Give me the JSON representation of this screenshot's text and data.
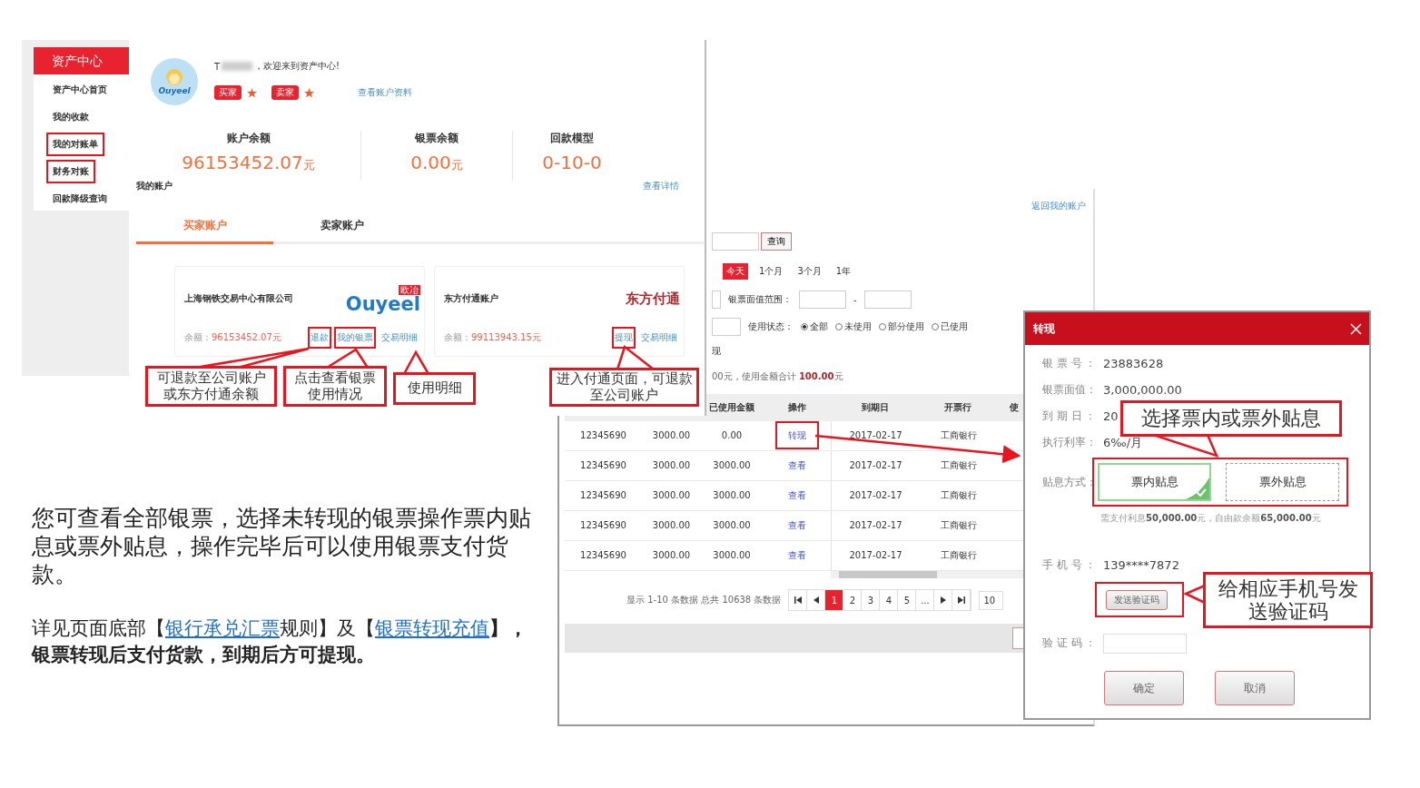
{
  "sidebar": {
    "title": "资产中心",
    "items": [
      {
        "label": "资产中心首页",
        "highlighted": false
      },
      {
        "label": "我的收款",
        "highlighted": false
      },
      {
        "label": "我的对账单",
        "highlighted": true
      },
      {
        "label": "财务对账",
        "highlighted": true
      },
      {
        "label": "回款降级查询",
        "highlighted": false
      }
    ]
  },
  "profile": {
    "avatar_text": "Ouyeel",
    "name_initial": "T",
    "greeting": "，欢迎来到资产中心!",
    "roles": [
      "买家",
      "卖家"
    ],
    "profile_link": "查看账户资料"
  },
  "stats": [
    {
      "label": "账户余额",
      "value": "96153452.07",
      "unit": "元"
    },
    {
      "label": "银票余额",
      "value": "0.00",
      "unit": "元"
    },
    {
      "label": "回款模型",
      "value": "0-10-0"
    }
  ],
  "section_label": "我的账户",
  "details_link": "查看详情",
  "tabs": [
    {
      "label": "买家账户",
      "selected": true
    },
    {
      "label": "卖家账户",
      "selected": false
    }
  ],
  "accounts": [
    {
      "name": "上海钢铁交易中心有限公司",
      "kind": "ouyeel",
      "logo_text": "Ouyeel",
      "logo_badge": "欧冶",
      "balance_label": "余额：",
      "balance": "96153452.07元",
      "actions": [
        {
          "label": "退款",
          "highlighted": true
        },
        {
          "label": "我的银票",
          "highlighted": true
        },
        {
          "label": "交易明细",
          "highlighted": false
        }
      ]
    },
    {
      "name": "东方付通账户",
      "kind": "seal",
      "logo_text": "东方付通",
      "balance_label": "余额：",
      "balance": "99113943.15元",
      "actions": [
        {
          "label": "提现",
          "highlighted": true
        },
        {
          "label": "交易明细",
          "highlighted": false
        }
      ]
    }
  ],
  "bill_list": {
    "back_link": "返回我的账户",
    "query_button": "查询",
    "periods": [
      {
        "label": "今天",
        "selected": true
      },
      {
        "label": "1个月",
        "selected": false
      },
      {
        "label": "3个月",
        "selected": false
      },
      {
        "label": "1年",
        "selected": false
      }
    ],
    "range_label": "银票面值范围：",
    "range_separator": "-",
    "status_label": "使用状态：",
    "status_options": [
      {
        "label": "全部",
        "selected": true
      },
      {
        "label": "未使用",
        "selected": false
      },
      {
        "label": "部分使用",
        "selected": false
      },
      {
        "label": "已使用",
        "selected": false
      }
    ],
    "cut_label": "现",
    "summary": "00元，使用金额合计 **100.00**元",
    "columns": [
      "",
      "",
      "已使用金额",
      "操作",
      "到期日",
      "开票行",
      "使"
    ],
    "rows": [
      {
        "cells": [
          "12345690",
          "3000.00",
          "0.00",
          "转现",
          "2017-02-17",
          "工商银行"
        ],
        "highlighted": true
      },
      {
        "cells": [
          "12345690",
          "3000.00",
          "3000.00",
          "查看",
          "2017-02-17",
          "工商银行"
        ],
        "highlighted": false
      },
      {
        "cells": [
          "12345690",
          "3000.00",
          "3000.00",
          "查看",
          "2017-02-17",
          "工商银行"
        ],
        "highlighted": false
      },
      {
        "cells": [
          "12345690",
          "3000.00",
          "3000.00",
          "查看",
          "2017-02-17",
          "工商银行"
        ],
        "highlighted": false
      },
      {
        "cells": [
          "12345690",
          "3000.00",
          "3000.00",
          "查看",
          "2017-02-17",
          "工商银行"
        ],
        "highlighted": false
      }
    ],
    "pagination": {
      "info": "显示 1-10 条数据 总共 10638 条数据",
      "pages": [
        {
          "label": "1",
          "selected": true
        },
        {
          "label": "2",
          "selected": false
        },
        {
          "label": "3",
          "selected": false
        },
        {
          "label": "4",
          "selected": false
        },
        {
          "label": "5",
          "selected": false
        },
        {
          "label": "...",
          "selected": false
        }
      ],
      "page_size": "10"
    }
  },
  "dialog": {
    "title": "转现",
    "fields": [
      {
        "label": "银 票 号 ：",
        "value": "23883628"
      },
      {
        "label": "银票面值：",
        "value": "3,000,000.00"
      },
      {
        "label": "到 期 日 ：",
        "value": "20"
      },
      {
        "label": "执行利率：",
        "value": "6‰/月"
      }
    ],
    "discount_label": "贴息方式：",
    "discount_highlighted": true,
    "discount_options": [
      {
        "label": "票内贴息",
        "selected": true
      },
      {
        "label": "票外贴息",
        "selected": false
      }
    ],
    "note": "需支付利息**50,000.00**元，自由款余额**65,000.00**元",
    "phone_label": "手 机 号 ：",
    "phone": "139****7872",
    "send_button": "发送验证码",
    "send_highlighted": true,
    "code_label": "验 证 码 ：",
    "buttons": [
      "确定",
      "取消"
    ]
  },
  "callouts": [
    {
      "text": "可退款至公司账户或东方付通余额"
    },
    {
      "text": "点击查看银票使用情况"
    },
    {
      "text": "使用明细"
    },
    {
      "text": "进入付通页面，可退款至公司账户"
    },
    {
      "text": "选择票内或票外贴息"
    },
    {
      "text": "给相应手机号发送验证码"
    }
  ],
  "description": {
    "paragraph": "您可查看全部银票，选择未转现的银票操作票内贴息或票外贴息，操作完毕后可以使用银票支付货款。",
    "segments": [
      {
        "kind": "plain",
        "text": "详见页面底部【"
      },
      {
        "kind": "link",
        "text": "银行承兑汇票"
      },
      {
        "kind": "plain",
        "text": "规则】及【"
      },
      {
        "kind": "link",
        "text": "银票转现充值"
      },
      {
        "kind": "bold",
        "text": "】，银票转现后支付货款，到期后方可提现。"
      }
    ]
  }
}
